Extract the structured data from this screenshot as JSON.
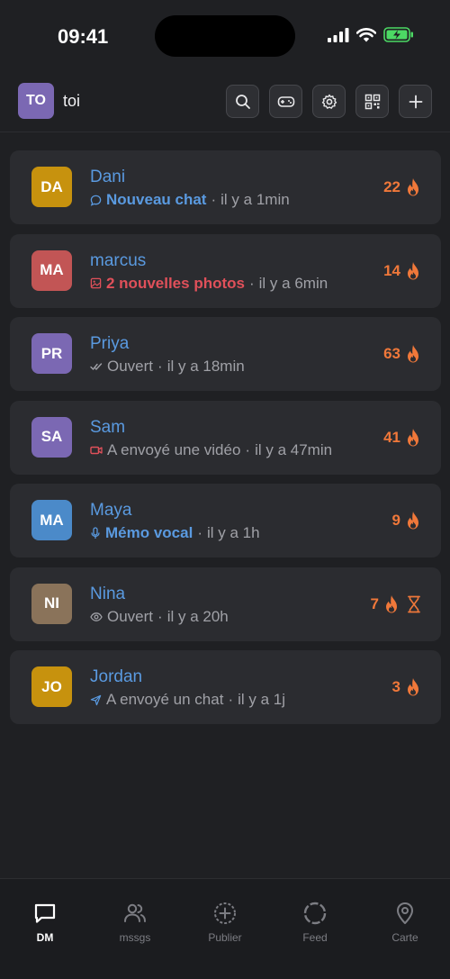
{
  "status_bar": {
    "time": "09:41"
  },
  "header": {
    "avatar_initials": "TO",
    "avatar_color": "#7b68b3",
    "username": "toi",
    "buttons": [
      {
        "icon": "search-icon"
      },
      {
        "icon": "gamepad-icon"
      },
      {
        "icon": "gear-icon"
      },
      {
        "icon": "qr-code-icon"
      },
      {
        "icon": "plus-icon"
      }
    ]
  },
  "conversations": [
    {
      "initials": "DA",
      "avatar_color": "#c7920e",
      "name": "Dani",
      "status_icon": "chat-bubble-icon",
      "status": "Nouveau chat",
      "status_style": "blue",
      "time": "il y a 1min",
      "streak": "22",
      "expiring": false
    },
    {
      "initials": "MA",
      "avatar_color": "#c25555",
      "name": "marcus",
      "status_icon": "photo-icon",
      "status": "2 nouvelles photos",
      "status_style": "red",
      "time": "il y a 6min",
      "streak": "14",
      "expiring": false
    },
    {
      "initials": "PR",
      "avatar_color": "#7b68b3",
      "name": "Priya",
      "status_icon": "double-check-icon",
      "status": "Ouvert",
      "status_style": "gray",
      "time": "il y a 18min",
      "streak": "63",
      "expiring": false
    },
    {
      "initials": "SA",
      "avatar_color": "#7b68b3",
      "name": "Sam",
      "status_icon": "video-icon",
      "status": "A envoyé une vidéo",
      "status_style": "gray",
      "time": "il y a 47min",
      "streak": "41",
      "expiring": false
    },
    {
      "initials": "MA",
      "avatar_color": "#4b8ac9",
      "name": "Maya",
      "status_icon": "microphone-icon",
      "status": "Mémo vocal",
      "status_style": "blue",
      "time": "il y a 1h",
      "streak": "9",
      "expiring": false
    },
    {
      "initials": "NI",
      "avatar_color": "#8a735a",
      "name": "Nina",
      "status_icon": "eye-icon",
      "status": "Ouvert",
      "status_style": "gray",
      "time": "il y a 20h",
      "streak": "7",
      "expiring": true
    },
    {
      "initials": "JO",
      "avatar_color": "#c7920e",
      "name": "Jordan",
      "status_icon": "send-arrow-icon",
      "status": "A envoyé un chat",
      "status_style": "gray",
      "time": "il y a 1j",
      "streak": "3",
      "expiring": false
    }
  ],
  "separator": "·",
  "colors": {
    "accent_blue": "#5a9ae0",
    "accent_red": "#e0505a",
    "streak_orange": "#f0783a",
    "background": "#1f2023",
    "card": "#2b2c30"
  },
  "bottom_nav": [
    {
      "icon": "chat-bubble-icon",
      "label": "DM",
      "active": true
    },
    {
      "icon": "users-icon",
      "label": "mssgs",
      "active": false
    },
    {
      "icon": "add-circle-icon",
      "label": "Publier",
      "active": false
    },
    {
      "icon": "circle-ring-icon",
      "label": "Feed",
      "active": false
    },
    {
      "icon": "map-pin-icon",
      "label": "Carte",
      "active": false
    }
  ]
}
